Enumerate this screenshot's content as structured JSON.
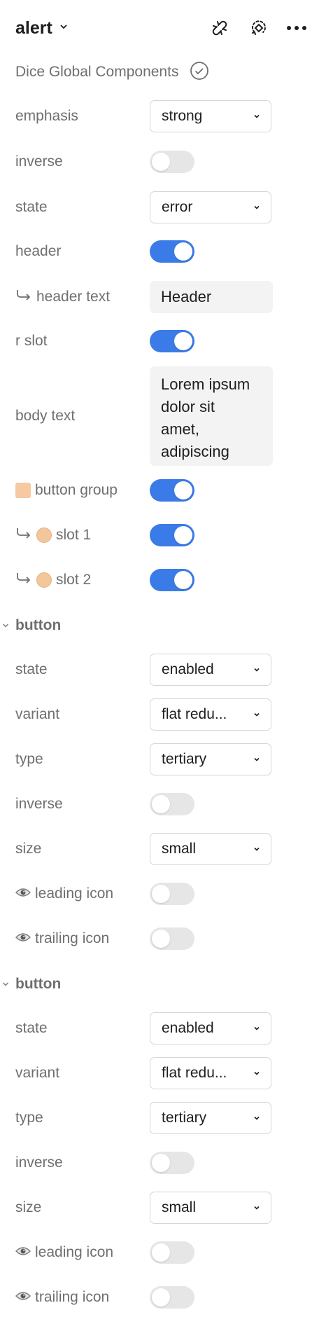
{
  "header": {
    "title": "alert",
    "library": "Dice Global Components",
    "icons": [
      "chevron-down-icon",
      "detach-instance-icon",
      "go-to-main-component-icon",
      "more-icon",
      "check-circle-icon"
    ]
  },
  "props": {
    "emphasis": {
      "label": "emphasis",
      "value": "strong"
    },
    "inverse": {
      "label": "inverse",
      "on": false
    },
    "state": {
      "label": "state",
      "value": "error"
    },
    "header": {
      "label": "header",
      "on": true
    },
    "header_text": {
      "label": "header text",
      "value": "Header"
    },
    "r_slot": {
      "label": "r slot",
      "on": true
    },
    "body_text": {
      "label": "body text",
      "lines": [
        "Lorem ipsum",
        "dolor sit",
        "amet,",
        "adipiscing"
      ]
    },
    "button_group": {
      "label": "button group",
      "on": true
    },
    "slot1": {
      "label": "slot 1",
      "on": true
    },
    "slot2": {
      "label": "slot 2",
      "on": true
    }
  },
  "sections": [
    {
      "title": "button",
      "state": {
        "label": "state",
        "value": "enabled"
      },
      "variant": {
        "label": "variant",
        "value": "flat redu..."
      },
      "type": {
        "label": "type",
        "value": "tertiary"
      },
      "inverse": {
        "label": "inverse",
        "on": false
      },
      "size": {
        "label": "size",
        "value": "small"
      },
      "leading_icon": {
        "label": "leading icon",
        "on": false
      },
      "trailing_icon": {
        "label": "trailing icon",
        "on": false
      }
    },
    {
      "title": "button",
      "state": {
        "label": "state",
        "value": "enabled"
      },
      "variant": {
        "label": "variant",
        "value": "flat redu..."
      },
      "type": {
        "label": "type",
        "value": "tertiary"
      },
      "inverse": {
        "label": "inverse",
        "on": false
      },
      "size": {
        "label": "size",
        "value": "small"
      },
      "leading_icon": {
        "label": "leading icon",
        "on": false
      },
      "trailing_icon": {
        "label": "trailing icon",
        "on": false
      }
    }
  ],
  "colors": {
    "toggle_on": "#3b7be8",
    "toggle_off": "#e6e6e6",
    "label_gray": "#6f6f6f",
    "text_dark": "#1e1e1e"
  }
}
